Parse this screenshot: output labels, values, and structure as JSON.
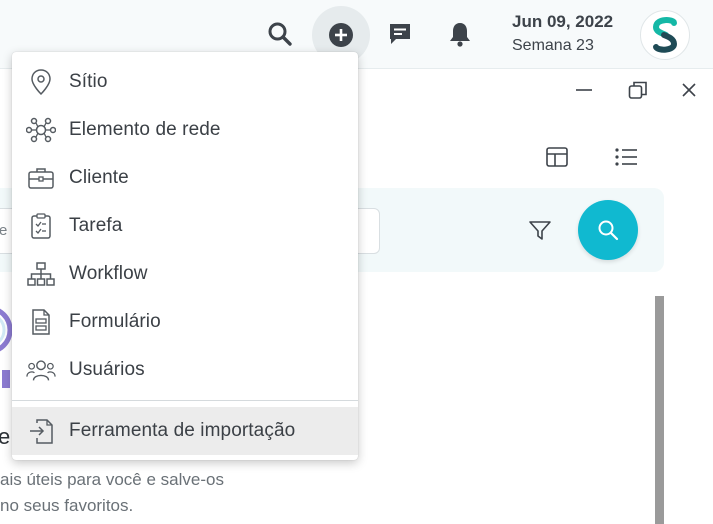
{
  "header": {
    "date": "Jun 09, 2022",
    "week": "Semana 23",
    "icons": [
      "search-icon",
      "add-circle-icon",
      "chat-icon",
      "bell-icon"
    ]
  },
  "menu": {
    "items": [
      {
        "label": "Sítio",
        "icon": "location-pin-icon"
      },
      {
        "label": "Elemento de rede",
        "icon": "network-element-icon"
      },
      {
        "label": "Cliente",
        "icon": "briefcase-icon"
      },
      {
        "label": "Tarefa",
        "icon": "clipboard-task-icon"
      },
      {
        "label": "Workflow",
        "icon": "workflow-icon"
      },
      {
        "label": "Formulário",
        "icon": "form-icon"
      },
      {
        "label": "Usuários",
        "icon": "users-icon"
      },
      {
        "label": "Ferramenta de importação",
        "icon": "import-icon"
      }
    ]
  },
  "search": {
    "field_partial": "e"
  },
  "background": {
    "heading_partial": "e",
    "text_line1": "ais úteis para você e salve-os",
    "text_line2": "no seus favoritos."
  },
  "colors": {
    "accent": "#10b9d0",
    "brand_teal": "#14b8a6",
    "brand_dark": "#1f4b56",
    "menu_highlight": "#ececec"
  }
}
